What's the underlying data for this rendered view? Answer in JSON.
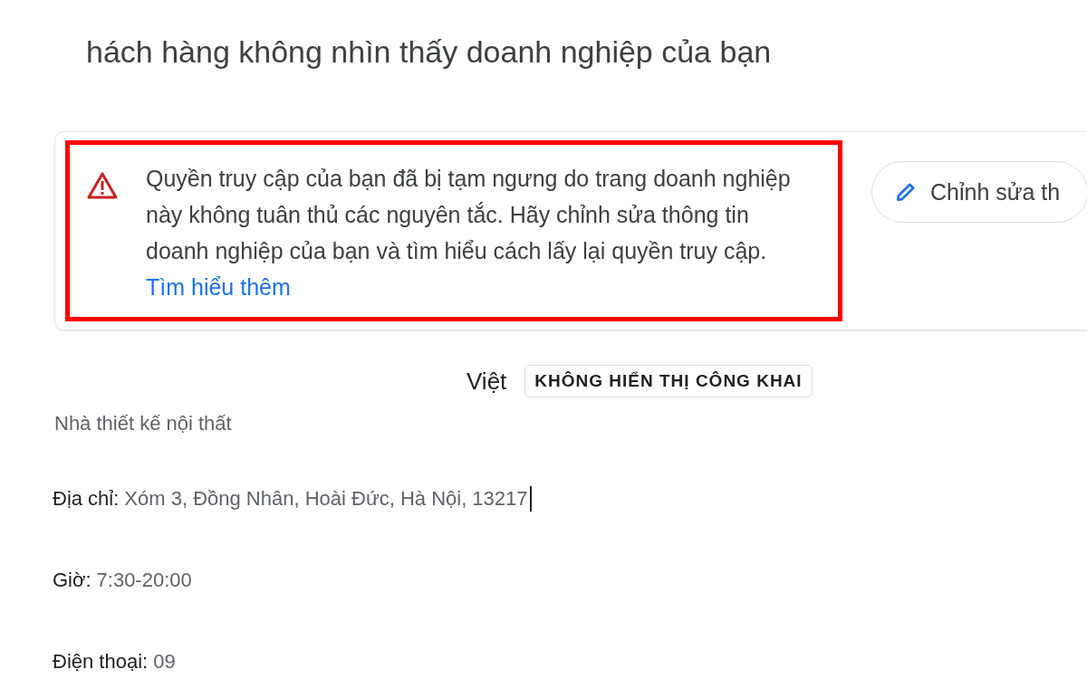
{
  "page_title": "hách hàng không nhìn thấy doanh nghiệp của bạn",
  "alert": {
    "message": "Quyền truy cập của bạn đã bị tạm ngưng do trang doanh nghiệp này không tuân thủ các nguyên tắc. Hãy chỉnh sửa thông tin doanh nghiệp của bạn và tìm hiểu cách lấy lại quyền truy cập.",
    "link": "Tìm hiểu thêm",
    "highlighted": true
  },
  "edit_button": {
    "label": "Chỉnh sửa th"
  },
  "business": {
    "name": "Việt",
    "badge": "KHÔNG HIỂN THỊ CÔNG KHAI",
    "category": "Nhà thiết kế nội thất"
  },
  "details": [
    {
      "label": "Địa chỉ:",
      "value": "Xóm 3, Đồng Nhân, Hoài Đức, Hà Nội, 13217",
      "cursor": true
    },
    {
      "label": "Giờ:",
      "value": "7:30-20:00",
      "cursor": false
    },
    {
      "label": "Điện thoại:",
      "value": "09",
      "cursor": false
    }
  ]
}
